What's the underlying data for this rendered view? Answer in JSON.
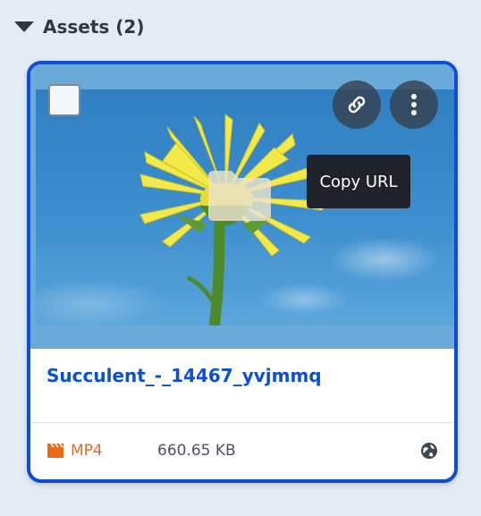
{
  "section": {
    "title": "Assets (2)"
  },
  "asset": {
    "name": "Succulent_-_14467_yvjmmq",
    "type": "MP4",
    "size": "660.65 KB",
    "tooltip": "Copy URL"
  },
  "icons": {
    "collapse": "triangle-down-icon",
    "copy": "link-icon",
    "more": "vertical-ellipsis-icon",
    "type": "film-clapper-icon",
    "visibility": "globe-icon",
    "placeholder": "folder-icon"
  },
  "colors": {
    "accent": "#0a4fd4",
    "type": "#e86a1a",
    "tooltip_bg": "#1f2329",
    "background": "#e5ebf3"
  }
}
